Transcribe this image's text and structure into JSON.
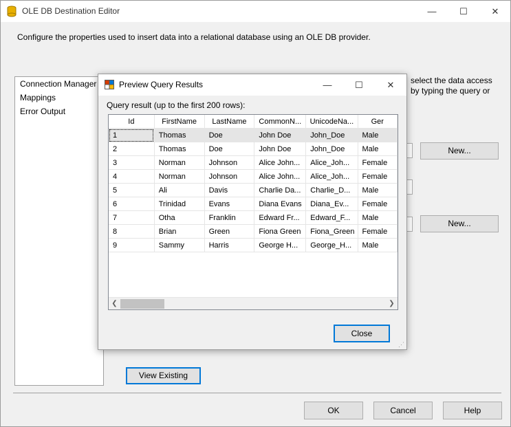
{
  "main": {
    "title": "OLE DB Destination Editor",
    "description": "Configure the properties used to insert data into a relational database using an OLE DB provider.",
    "nav": [
      "Connection Manager",
      "Mappings",
      "Error Output"
    ],
    "bg_text_line1": "select the data access",
    "bg_text_line2": "by typing the query or",
    "new_button_1": "New...",
    "new_button_2": "New...",
    "view_existing": "View Existing",
    "ok": "OK",
    "cancel": "Cancel",
    "help": "Help",
    "controls": {
      "minimize": "—",
      "maximize": "☐",
      "close": "✕"
    }
  },
  "dialog": {
    "title": "Preview Query Results",
    "label": "Query result (up to the first 200 rows):",
    "close_button": "Close",
    "controls": {
      "minimize": "—",
      "maximize": "☐",
      "close": "✕"
    },
    "columns": [
      "Id",
      "FirstName",
      "LastName",
      "CommonN...",
      "UnicodeNa...",
      "Ger"
    ],
    "rows": [
      [
        "1",
        "Thomas",
        "Doe",
        "John Doe",
        "John_Doe",
        "Male"
      ],
      [
        "2",
        "Thomas",
        "Doe",
        "John Doe",
        "John_Doe",
        "Male"
      ],
      [
        "3",
        "Norman",
        "Johnson",
        "Alice John...",
        "Alice_Joh...",
        "Female"
      ],
      [
        "4",
        "Norman",
        "Johnson",
        "Alice John...",
        "Alice_Joh...",
        "Female"
      ],
      [
        "5",
        "Ali",
        "Davis",
        "Charlie Da...",
        "Charlie_D...",
        "Male"
      ],
      [
        "6",
        "Trinidad",
        "Evans",
        "Diana Evans",
        "Diana_Ev...",
        "Female"
      ],
      [
        "7",
        "Otha",
        "Franklin",
        "Edward Fr...",
        "Edward_F...",
        "Male"
      ],
      [
        "8",
        "Brian",
        "Green",
        "Fiona Green",
        "Fiona_Green",
        "Female"
      ],
      [
        "9",
        "Sammy",
        "Harris",
        "George H...",
        "George_H...",
        "Male"
      ]
    ],
    "selected_row": 0
  }
}
